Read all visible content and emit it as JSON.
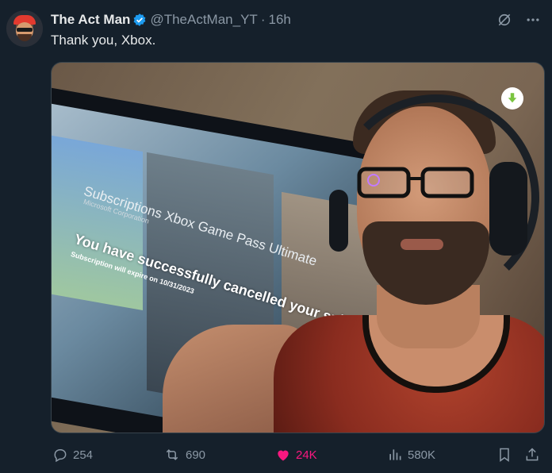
{
  "tweet": {
    "author_name": "The Act Man",
    "handle": "@TheActMan_YT",
    "separator": "·",
    "time": "16h",
    "text": "Thank you, Xbox."
  },
  "media_text": {
    "subscriptions": "Subscriptions",
    "corporation": "Microsoft Corporation",
    "product": "Xbox Game Pass Ultimate",
    "message": "You have successfully cancelled your subscription",
    "expiry": "Subscription will expire on 10/31/2023"
  },
  "actions": {
    "replies": "254",
    "reposts": "690",
    "likes": "24K",
    "views": "580K"
  },
  "colors": {
    "background": "#15202b",
    "text": "#e7e9ea",
    "muted": "#8b98a5",
    "like": "#f91880",
    "verified": "#1d9bf0",
    "download_badge": "#7ac43f"
  },
  "icons": [
    "verified-badge-icon",
    "grok-icon",
    "more-icon",
    "download-icon",
    "reply-icon",
    "repost-icon",
    "like-icon",
    "views-icon",
    "bookmark-icon",
    "share-icon"
  ]
}
